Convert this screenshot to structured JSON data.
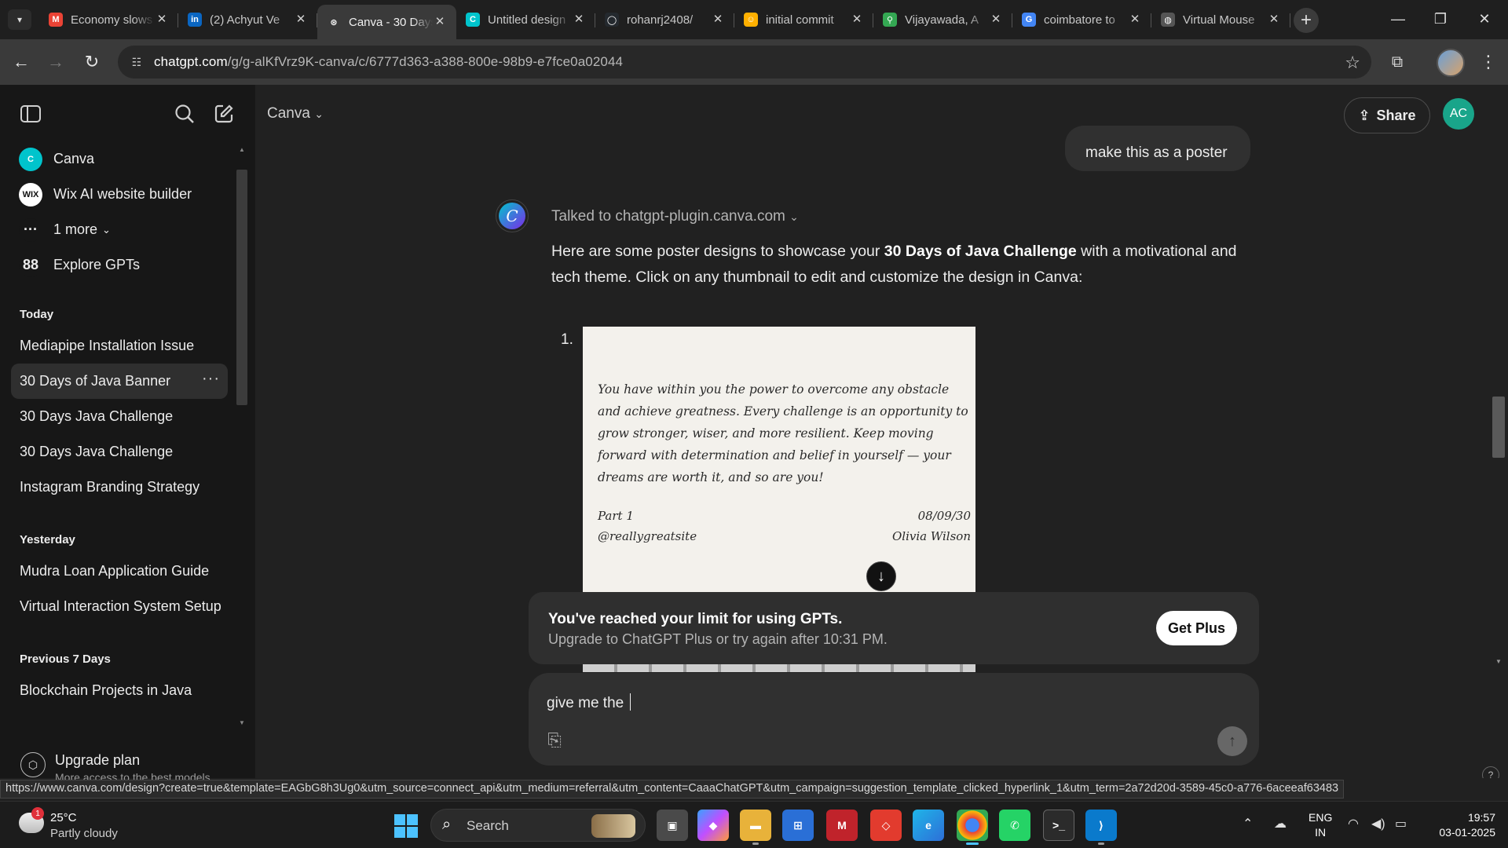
{
  "browser": {
    "tabs": [
      {
        "title": "Economy slows",
        "icon": "gmail-icon",
        "color": "#ea4335",
        "glyph": "M"
      },
      {
        "title": "(2) Achyut Ve",
        "icon": "linkedin-icon",
        "color": "#0a66c2",
        "glyph": "in"
      },
      {
        "title": "Canva - 30 Days",
        "icon": "chatgpt-icon",
        "color": "#3a3a3a",
        "glyph": "⊛",
        "active": true
      },
      {
        "title": "Untitled design",
        "icon": "canva-icon",
        "color": "#00c4cc",
        "glyph": "C"
      },
      {
        "title": "rohanrj2408/",
        "icon": "github-icon",
        "color": "#24292e",
        "glyph": "◯"
      },
      {
        "title": "initial commit",
        "icon": "huggingface-icon",
        "color": "#ffb000",
        "glyph": "☺"
      },
      {
        "title": "Vijayawada, A",
        "icon": "maps-icon",
        "color": "#34a853",
        "glyph": "⚲"
      },
      {
        "title": "coimbatore to",
        "icon": "google-icon",
        "color": "#4285f4",
        "glyph": "G"
      },
      {
        "title": "Virtual Mouse",
        "icon": "globe-icon",
        "color": "#555555",
        "glyph": "◍"
      }
    ],
    "url_host": "chatgpt.com",
    "url_path": "/g/g-alKfVrz9K-canva/c/6777d363-a388-800e-98b9-e7fce0a02044",
    "status_url": "https://www.canva.com/design?create=true&template=EAGbG8h3Ug0&utm_source=connect_api&utm_medium=referral&utm_content=CaaaChatGPT&utm_campaign=suggestion_template_clicked_hyperlink_1&utm_term=2a72d20d-3589-45c0-a776-6aceeaf63483"
  },
  "sidebar": {
    "gpts": [
      {
        "label": "Canva",
        "badge": "C",
        "color": "#00c4cc"
      },
      {
        "label": "Wix AI website builder",
        "badge": "WIX",
        "color": "#ffffff"
      },
      {
        "label": "1 more",
        "badge": "···",
        "color": "#171717"
      },
      {
        "label": "Explore GPTs",
        "badge": "88",
        "color": "#171717"
      }
    ],
    "sections": [
      {
        "title": "Today",
        "items": [
          "Mediapipe Installation Issue",
          "30 Days of Java Banner",
          "30 Days Java Challenge",
          "30 Days Java Challenge",
          "Instagram Branding Strategy"
        ]
      },
      {
        "title": "Yesterday",
        "items": [
          "Mudra Loan Application Guide",
          "Virtual Interaction System Setup"
        ]
      },
      {
        "title": "Previous 7 Days",
        "items": [
          "Blockchain Projects in Java"
        ]
      }
    ],
    "active_item": "30 Days of Java Banner",
    "upgrade_title": "Upgrade plan",
    "upgrade_sub": "More access to the best models"
  },
  "header": {
    "model": "Canva",
    "share": "Share",
    "avatar": "AC"
  },
  "chat": {
    "user_message": "make this as a poster",
    "talked_to": "Talked to chatgpt-plugin.canva.com",
    "reply_pre": "Here are some poster designs to showcase your ",
    "reply_bold": "30 Days of Java Challenge",
    "reply_post": " with a motivational and tech theme. Click on any thumbnail to edit and customize the design in Canva:",
    "item_number": "1.",
    "poster": {
      "quote": "You have within you the power to overcome any obstacle and achieve greatness. Every challenge is an opportunity to grow stronger, wiser, and more resilient. Keep moving forward with determination and belief in yourself — your dreams are worth it, and so are you!",
      "part": "Part 1",
      "handle": "@reallygreatsite",
      "date": "08/09/30",
      "author": "Olivia Wilson"
    }
  },
  "limit": {
    "title": "You've reached your limit for using GPTs.",
    "subtitle": "Upgrade to ChatGPT Plus or try again after 10:31 PM.",
    "button": "Get Plus"
  },
  "composer": {
    "value": "give me the "
  },
  "taskbar": {
    "temp": "25°C",
    "weather": "Partly cloudy",
    "weather_badge": "1",
    "search": "Search",
    "lang1": "ENG",
    "lang2": "IN",
    "time": "19:57",
    "date": "03-01-2025"
  }
}
